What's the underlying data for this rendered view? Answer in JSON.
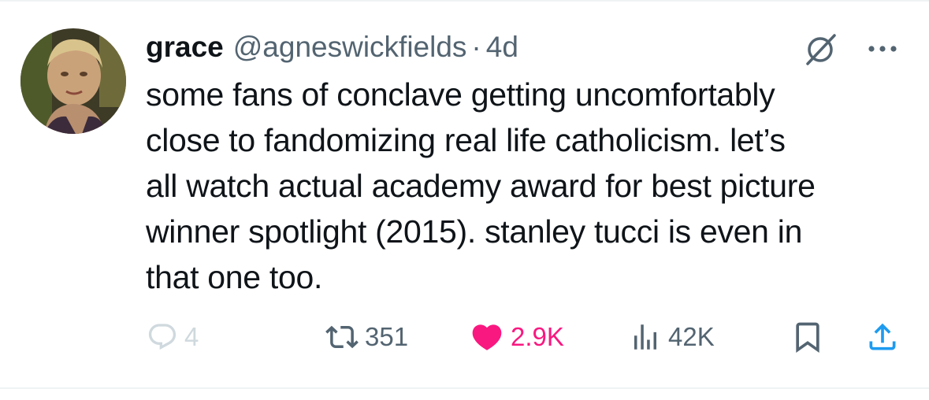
{
  "post": {
    "display_name": "grace",
    "handle": "@agneswickfields",
    "separator": "·",
    "timestamp": "4d",
    "text": "some fans of conclave getting uncomfortably\nclose to fandomizing real life catholicism. let’s\nall watch actual academy award for best picture\nwinner spotlight (2015). stanley tucci is even in\nthat one too."
  },
  "actions": {
    "reply_count": "4",
    "repost_count": "351",
    "like_count": "2.9K",
    "view_count": "42K"
  },
  "icons": {
    "avatar": "profile-photo",
    "grok": "grok-icon",
    "more": "more-icon",
    "reply": "reply-icon",
    "repost": "repost-icon",
    "like": "heart-icon",
    "views": "views-icon",
    "bookmark": "bookmark-icon",
    "share": "share-icon"
  },
  "colors": {
    "text_primary": "#0f1419",
    "text_secondary": "#536471",
    "like_active": "#f91880",
    "reply_muted": "#cfd9de"
  }
}
